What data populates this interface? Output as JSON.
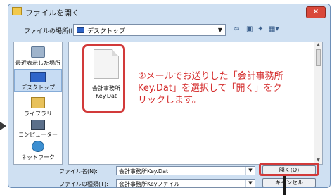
{
  "window": {
    "title": "ファイルを開く",
    "close_label": "×"
  },
  "lookin": {
    "label": "ファイルの場所(I):",
    "value": "デスクトップ"
  },
  "places": [
    {
      "label": "最近表示した場所"
    },
    {
      "label": "デスクトップ"
    },
    {
      "label": "ライブラリ"
    },
    {
      "label": "コンピューター"
    },
    {
      "label": "ネットワーク"
    }
  ],
  "file": {
    "name_line1": "会計事務所",
    "name_line2": "Key.Dat"
  },
  "annotation": {
    "text": "②メールでお送りした「会計事務所Key.Dat」を選択して「開く」をクリックします。"
  },
  "filename": {
    "label": "ファイル名(N):",
    "value": "会計事務所Key.Dat"
  },
  "filetype": {
    "label": "ファイルの種類(T):",
    "value": "会計事務所Keyファイル"
  },
  "buttons": {
    "open_label": "開く(O)",
    "cancel_label": "キャンセル"
  },
  "colors": {
    "accent_red": "#d23a3a",
    "dialog_bg": "#cfe0f2"
  }
}
